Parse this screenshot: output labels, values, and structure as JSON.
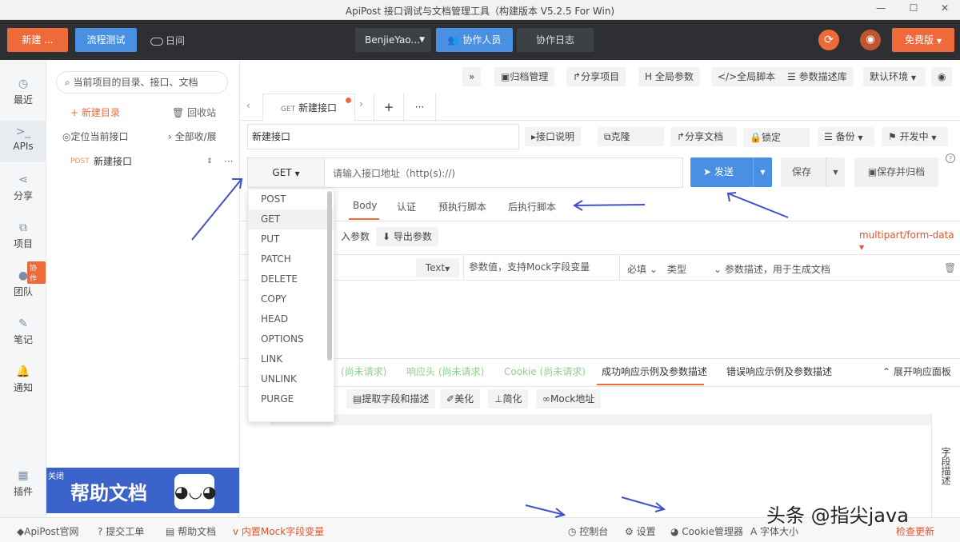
{
  "window": {
    "title": "ApiPost 接口调试与文档管理工具（构建版本 V5.2.5 For Win)"
  },
  "topbar": {
    "new_label": "新建 ...",
    "flow_label": "流程测试",
    "daylog_label": "日间",
    "user_label": "BenjieYao...",
    "collab_label": "协作人员",
    "collab_log_label": "协作日志",
    "free_label": "免费版"
  },
  "sidebar": {
    "items": [
      {
        "label": "最近",
        "icon": "clock-icon"
      },
      {
        "label": "APIs",
        "icon": "terminal-icon"
      },
      {
        "label": "分享",
        "icon": "share-icon"
      },
      {
        "label": "项目",
        "icon": "project-icon"
      },
      {
        "label": "团队",
        "icon": "team-icon"
      },
      {
        "label": "笔记",
        "icon": "note-icon"
      },
      {
        "label": "通知",
        "icon": "bell-icon"
      },
      {
        "label": "插件",
        "icon": "plugin-icon"
      }
    ],
    "team_badge": "协作"
  },
  "tree": {
    "search_placeholder": "当前项目的目录、接口、文档",
    "new_dir": "+ 新建目录",
    "recycle": "回收站",
    "locate": "定位当前接口",
    "collapse": "› 全部收/展",
    "item_method": "POST",
    "item_name": "新建接口",
    "help_close": "关闭",
    "help_title": "帮助文档"
  },
  "toolbar": {
    "expand": "»",
    "archive": "归档管理",
    "share_project": "分享项目",
    "global_params": "全局参数",
    "global_script": "全局脚本",
    "param_lib": "参数描述库",
    "env": "默认环境"
  },
  "tabs": {
    "method": "GET",
    "name": "新建接口",
    "add": "+",
    "more": "···"
  },
  "api": {
    "name_value": "新建接口",
    "doc_btn": "接口说明",
    "clone_btn": "克隆",
    "share_doc_btn": "分享文档",
    "lock_btn": "锁定",
    "backup_btn": "备份",
    "status_btn": "开发中",
    "method": "GET",
    "url_placeholder": "请输入接口地址（http(s)://)",
    "send": "发送",
    "save": "保存",
    "save_archive": "保存并归档"
  },
  "methods": [
    "POST",
    "GET",
    "PUT",
    "PATCH",
    "DELETE",
    "COPY",
    "HEAD",
    "OPTIONS",
    "LINK",
    "UNLINK",
    "PURGE"
  ],
  "req_tabs": [
    "Body",
    "认证",
    "预执行脚本",
    "后执行脚本"
  ],
  "body": {
    "import": "入参数",
    "export": "导出参数",
    "content_type": "multipart/form-data",
    "type_sel": "Text",
    "value_placeholder": "参数值，支持Mock字段变量",
    "required": "必填",
    "type": "类型",
    "desc_placeholder": "参数描述，用于生成文档"
  },
  "resp_tabs": {
    "t1": "(尚未请求)",
    "t2": "响应头 (尚未请求)",
    "t3": "Cookie (尚未请求)",
    "t4": "成功响应示例及参数描述",
    "t5": "错误响应示例及参数描述",
    "expand": "展开响应面板"
  },
  "resp_tools": [
    "提取字段和描述",
    "美化",
    "简化",
    "Mock地址"
  ],
  "side_label": "字段描述",
  "footer": {
    "official": "ApiPost官网",
    "ticket": "提交工单",
    "help": "帮助文档",
    "mock": "内置Mock字段变量",
    "console": "控制台",
    "settings": "设置",
    "cookie": "Cookie管理器",
    "font": "A 字体大小",
    "update": "检查更新"
  },
  "watermark": "头条 @指尖java"
}
